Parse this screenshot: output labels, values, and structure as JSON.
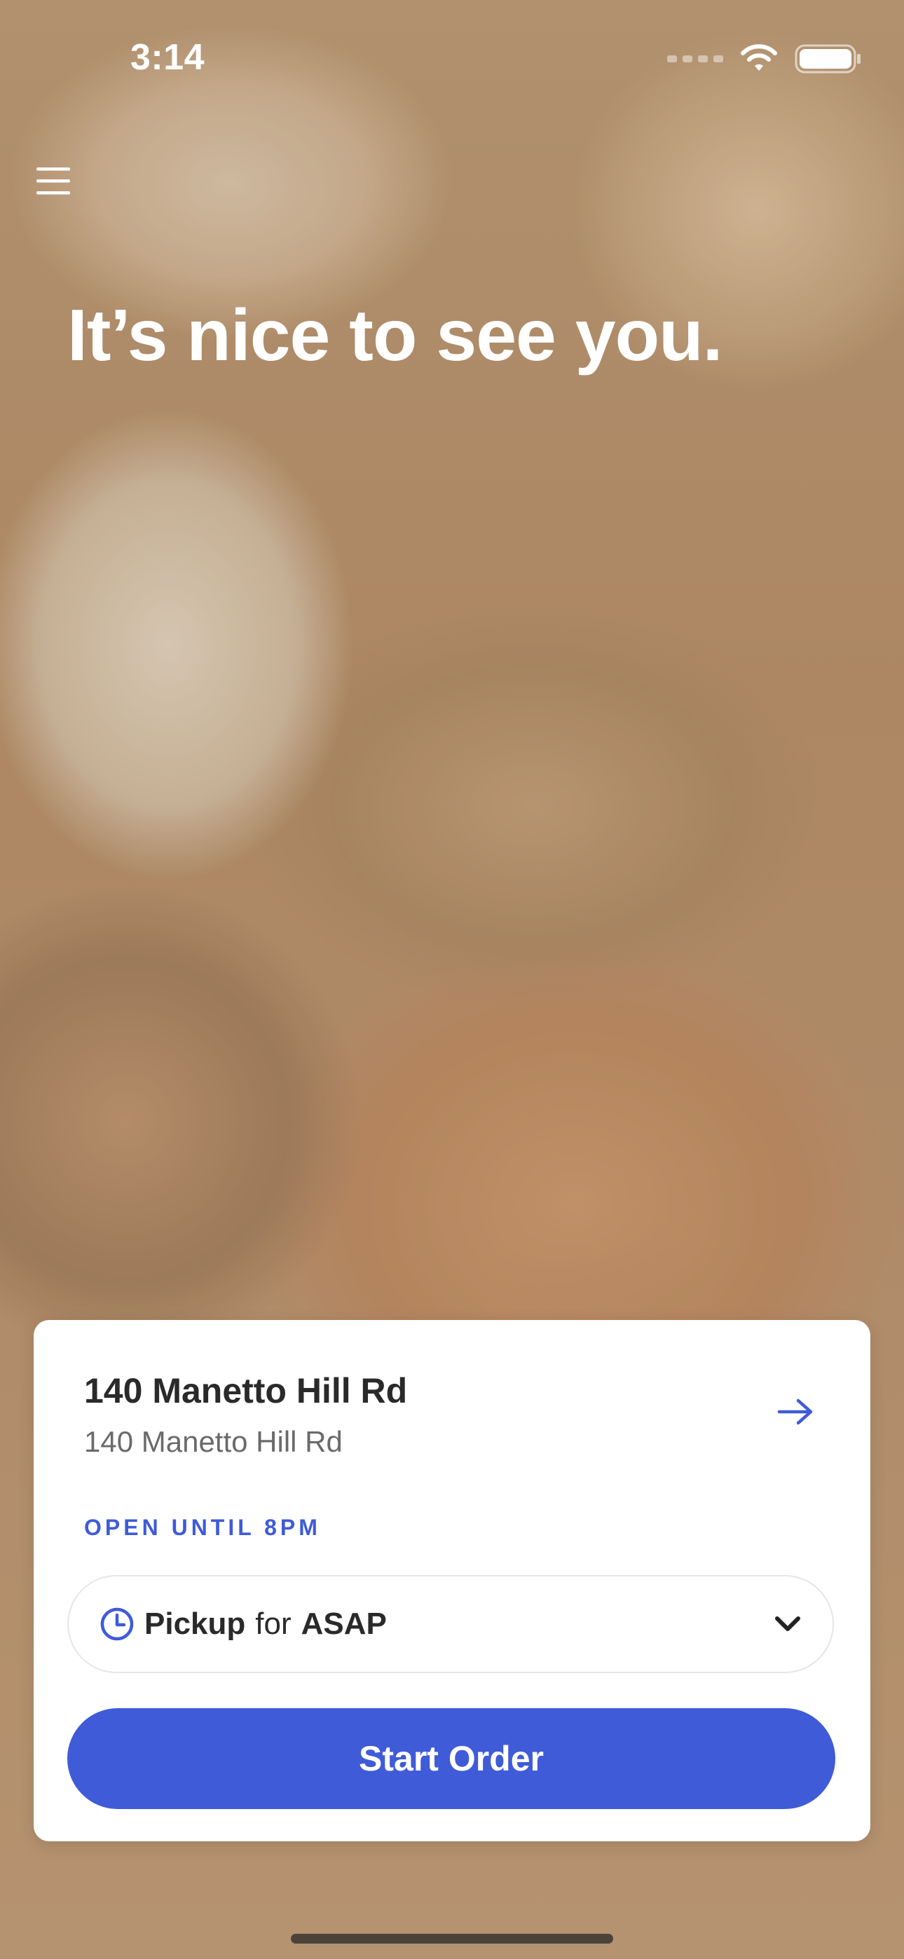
{
  "status_bar": {
    "time": "3:14",
    "icons": [
      "cellular-signal-icon",
      "wifi-icon",
      "battery-icon"
    ]
  },
  "header": {
    "menu_icon": "hamburger-menu-icon",
    "greeting": "It’s nice to see you."
  },
  "location_card": {
    "title": "140 Manetto Hill Rd",
    "address": "140 Manetto Hill Rd",
    "arrow_icon": "arrow-right-icon",
    "hours": "OPEN UNTIL 8PM",
    "order_type": {
      "mode": "Pickup",
      "connector": "for",
      "time": "ASAP",
      "icons": [
        "clock-icon",
        "chevron-down-icon"
      ]
    },
    "start_button_label": "Start Order"
  },
  "colors": {
    "accent": "#3f5bd8",
    "card_background": "#ffffff",
    "text_primary": "#2a2a2a",
    "text_secondary": "#6a6a6a"
  }
}
